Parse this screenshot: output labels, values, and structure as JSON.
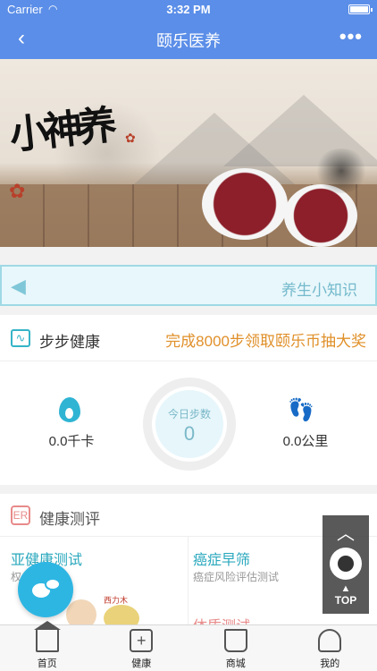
{
  "status_bar": {
    "carrier": "Carrier",
    "time": "3:32 PM"
  },
  "nav": {
    "back_glyph": "‹",
    "title": "颐乐医养",
    "more_glyph": "•••"
  },
  "banner": {
    "calligraphy": "小神养"
  },
  "tips": {
    "label": "养生小知识"
  },
  "steps": {
    "title": "步步健康",
    "promo": "完成8000步领取颐乐币抽大奖",
    "ring_caption": "今日步数",
    "step_count": "0",
    "calories": "0.0千卡",
    "distance": "0.0公里"
  },
  "evaluation": {
    "title": "健康测评",
    "items": [
      {
        "title": "亚健康测试",
        "subtitle": "权 型测试"
      },
      {
        "title": "癌症早筛",
        "subtitle": "癌症风险评估测试"
      },
      {
        "title": "体质测试"
      }
    ],
    "image_tag": "西力木"
  },
  "floating": {
    "top_label": "TOP"
  },
  "tabbar": {
    "items": [
      {
        "label": "首页",
        "icon": "home-icon"
      },
      {
        "label": "健康",
        "icon": "health-kit-icon"
      },
      {
        "label": "商城",
        "icon": "shopping-bag-icon"
      },
      {
        "label": "我的",
        "icon": "user-icon"
      }
    ]
  },
  "colors": {
    "nav_bar": "#5b8ee8",
    "accent_teal": "#2aa8bd",
    "promo_orange": "#e0902a",
    "chat_button": "#2eb6e3"
  }
}
